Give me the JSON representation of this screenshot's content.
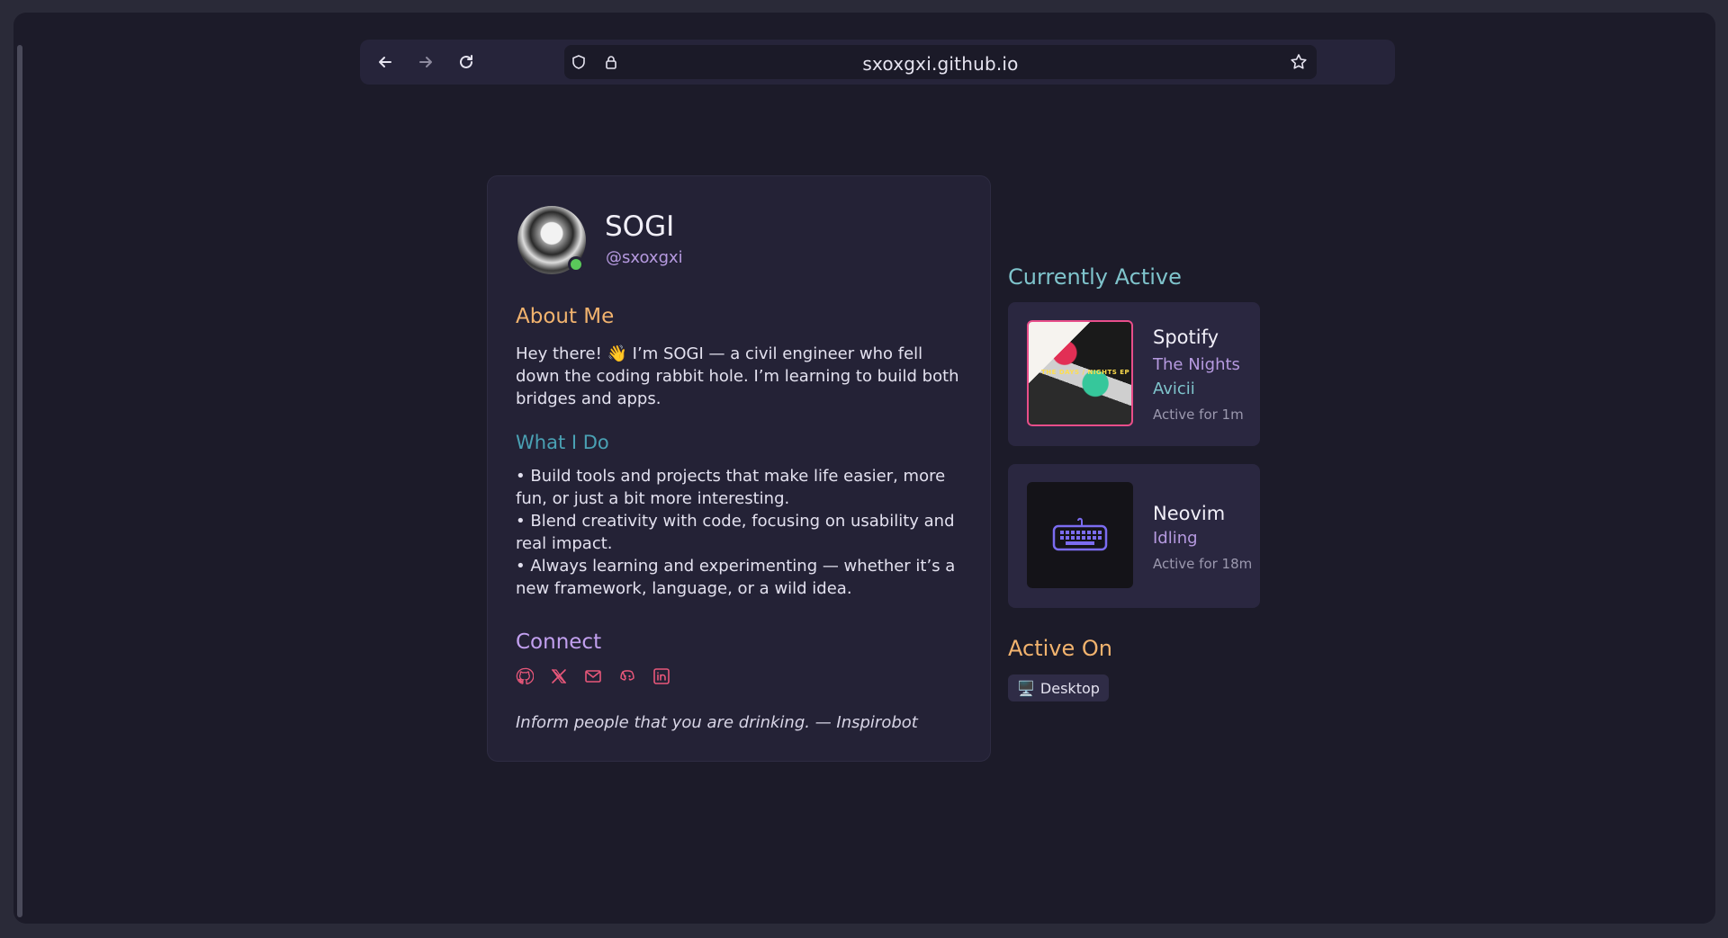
{
  "browser": {
    "url": "sxoxgxi.github.io",
    "back_icon": "arrow-left-icon",
    "forward_icon": "arrow-right-icon",
    "reload_icon": "reload-icon",
    "shield_icon": "shield-icon",
    "lock_icon": "lock-icon",
    "bookmark_icon": "star-icon"
  },
  "profile": {
    "name": "SOGI",
    "handle": "@sxoxgxi",
    "status_color": "#5ac85a"
  },
  "about": {
    "heading": "About Me",
    "text": "Hey there! 👋 I’m SOGI — a civil engineer who fell down the coding rabbit hole. I’m learning to build both bridges and apps."
  },
  "what": {
    "heading": "What I Do",
    "items": [
      "•  Build tools and projects that make life easier, more fun, or just a bit more interesting.",
      "•  Blend creativity with code, focusing on usability and real impact.",
      "•  Always learning and experimenting — whether it’s a new framework, language, or a wild idea."
    ]
  },
  "connect": {
    "heading": "Connect",
    "icons": [
      "github-icon",
      "x-icon",
      "email-icon",
      "discord-icon",
      "linkedin-icon"
    ]
  },
  "quote": "Inform people that you are drinking. — Inspirobot",
  "activity": {
    "heading": "Currently Active",
    "spotify": {
      "app": "Spotify",
      "track": "The Nights",
      "artist": "Avicii",
      "time": "Active for 1m",
      "art_label": "THE DAYS / NIGHTS EP"
    },
    "neovim": {
      "app": "Neovim",
      "state": "Idling",
      "time": "Active for 18m"
    }
  },
  "active_on": {
    "heading": "Active On",
    "device": "Desktop",
    "device_icon": "🖥️"
  },
  "colors": {
    "orange": "#f2b36e",
    "teal": "#4aa1b4",
    "purple": "#c2a0ef",
    "pink": "#e8577a"
  }
}
